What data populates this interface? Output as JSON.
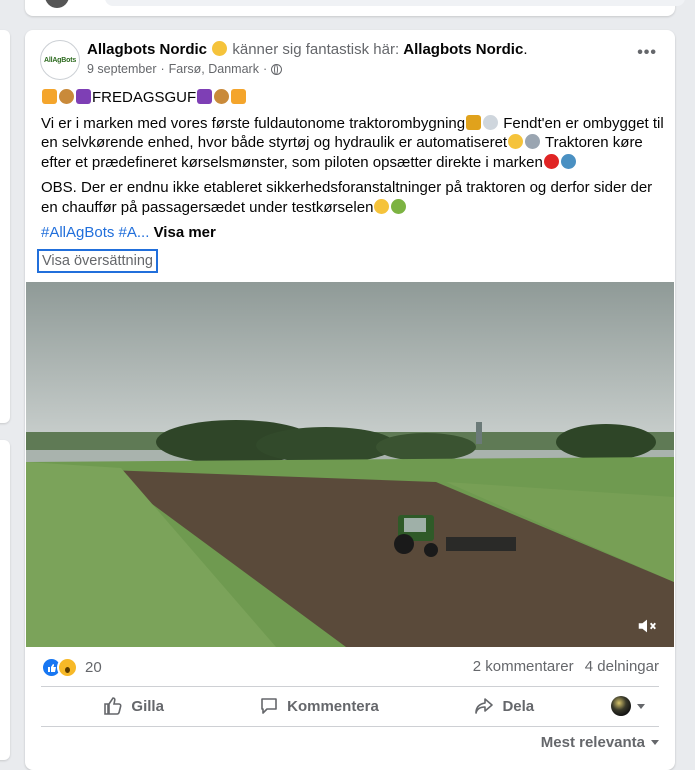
{
  "post": {
    "author": "Allagbots Nordic",
    "feeling_text": "känner sig fantastisk här:",
    "location_page": "Allagbots Nordic",
    "date": "9 september",
    "place": "Farsø, Danmark",
    "avatar_logo_text": "AllAgBots",
    "tag_line": "FREDAGSGUF",
    "paragraph1a": "Vi er i marken med vores første fuldautonome traktorombygning",
    "paragraph1b": " Fendt'en er ombygget til en selvkørende enhed, hvor både styrtøj og hydraulik er automatiseret",
    "paragraph1c": " Traktoren køre efter et prædefineret kørselsmønster, som piloten opsætter direkte i marken",
    "paragraph2": "OBS. Der er endnu ikke etableret sikkerhedsforanstaltninger på traktoren og derfor sider der en chauffør på passagersædet under testkørselen",
    "hashtags": "#AllAgBots #A...",
    "see_more": "Visa mer",
    "translate": "Visa översättning"
  },
  "stats": {
    "reaction_count": "20",
    "comments": "2 kommentarer",
    "shares": "4 delningar"
  },
  "actions": {
    "like": "Gilla",
    "comment": "Kommentera",
    "share": "Dela"
  },
  "sort_label": "Mest relevanta",
  "icons": [
    "more-icon",
    "globe-icon",
    "mute-icon",
    "like-icon",
    "comment-icon",
    "share-icon",
    "chevron-down-icon"
  ]
}
